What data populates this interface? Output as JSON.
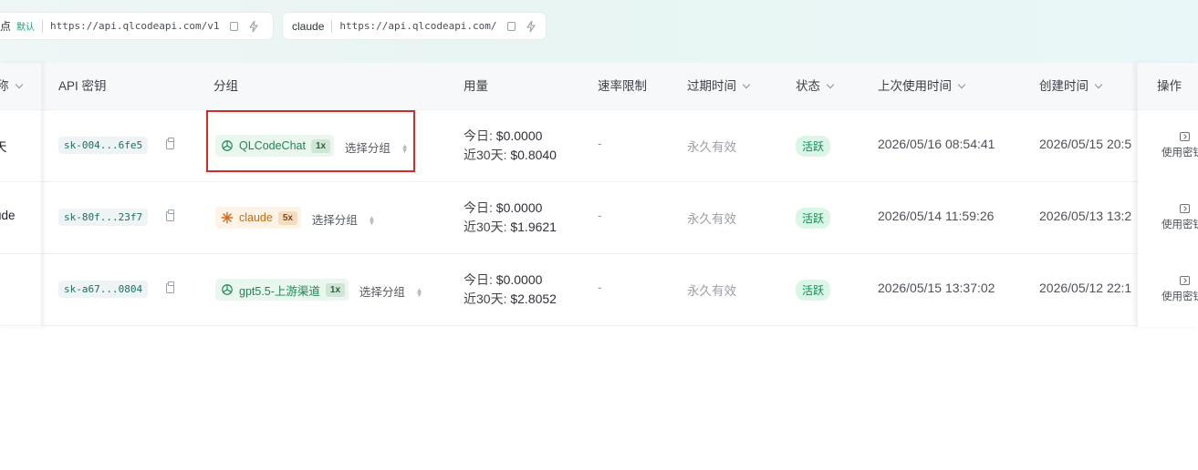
{
  "endpoints": [
    {
      "name_fragment": "点",
      "default_label": "默认",
      "url": "https://api.qlcodeapi.com/v1"
    },
    {
      "name": "claude",
      "url": "https://api.qlcodeapi.com/"
    }
  ],
  "table": {
    "headers": {
      "name_fragment": "称",
      "api_key": "API 密钥",
      "group": "分组",
      "usage": "用量",
      "rate_limit": "速率限制",
      "expire": "过期时间",
      "status": "状态",
      "last_used": "上次使用时间",
      "created": "创建时间",
      "actions": "操作"
    },
    "rows": [
      {
        "name_fragment": "天",
        "key": "sk-004...6fe5",
        "group_name": "QLCodeChat",
        "group_icon": "openai-icon",
        "multiplier": "1x",
        "select_label": "选择分组",
        "today_label": "今日:",
        "today_value": "$0.0000",
        "month_label": "近30天:",
        "month_value": "$0.8040",
        "rate_limit": "-",
        "expire": "永久有效",
        "status": "活跃",
        "last_used": "2026/05/16 08:54:41",
        "created": "2026/05/15 20:5",
        "action_label": "使用密钥"
      },
      {
        "name_fragment": "ude",
        "key": "sk-80f...23f7",
        "group_name": "claude",
        "group_icon": "claude-icon",
        "multiplier": "5x",
        "select_label": "选择分组",
        "today_label": "今日:",
        "today_value": "$0.0000",
        "month_label": "近30天:",
        "month_value": "$1.9621",
        "rate_limit": "-",
        "expire": "永久有效",
        "status": "活跃",
        "last_used": "2026/05/14 11:59:26",
        "created": "2026/05/13 13:2",
        "action_label": "使用密钥"
      },
      {
        "name_fragment": "",
        "key": "sk-a67...0804",
        "group_name": "gpt5.5-上游渠道",
        "group_icon": "openai-icon",
        "multiplier": "1x",
        "select_label": "选择分组",
        "today_label": "今日:",
        "today_value": "$0.0000",
        "month_label": "近30天:",
        "month_value": "$2.8052",
        "rate_limit": "-",
        "expire": "永久有效",
        "status": "活跃",
        "last_used": "2026/05/15 13:37:02",
        "created": "2026/05/12 22:1",
        "action_label": "使用密钥"
      }
    ]
  },
  "colors": {
    "accent": "#1aa37a",
    "status_bg": "#d9f6e6",
    "highlight": "#d42a2a"
  }
}
